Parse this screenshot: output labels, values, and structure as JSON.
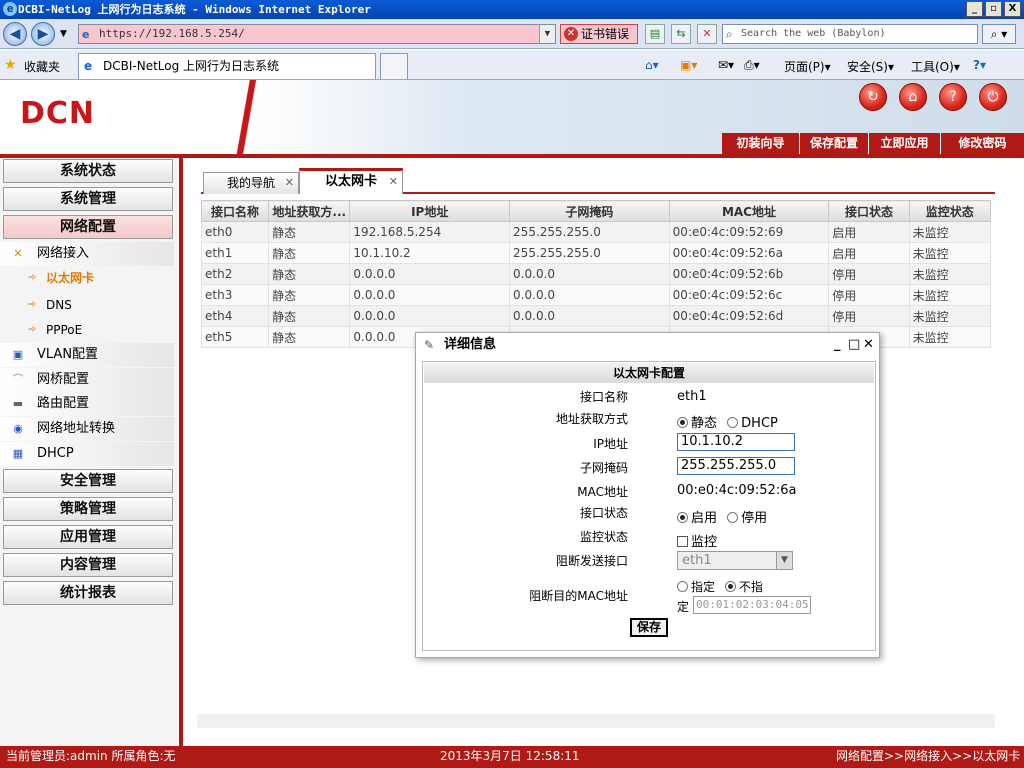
{
  "window": {
    "title": "DCBI-NetLog 上网行为日志系统 - Windows Internet Explorer",
    "controls": [
      "_",
      "▫",
      "X"
    ]
  },
  "browser": {
    "back": "◀",
    "forward": "▶",
    "dropdown": "▼",
    "address": "https://192.168.5.254/",
    "cert_error": "证书错误",
    "search_placeholder": "Search the web (Babylon)",
    "favorites_label": "收藏夹",
    "tab_title": "DCBI-NetLog 上网行为日志系统",
    "commands": {
      "page": "页面(P)",
      "safety": "安全(S)",
      "tools": "工具(O)"
    }
  },
  "app": {
    "logo": "DCN",
    "header_links": [
      "初装向导",
      "保存配置",
      "立即应用",
      "修改密码"
    ]
  },
  "sidebar": {
    "menu": {
      "status": "系统状态",
      "system": "系统管理",
      "network": "网络配置",
      "security": "安全管理",
      "policy": "策略管理",
      "application": "应用管理",
      "content": "内容管理",
      "report": "统计报表"
    },
    "network_items": {
      "access": "网络接入",
      "ethernet": "以太网卡",
      "dns": "DNS",
      "pppoe": "PPPoE",
      "vlan": "VLAN配置",
      "bridge": "网桥配置",
      "route": "路由配置",
      "nat": "网络地址转换",
      "dhcp": "DHCP"
    }
  },
  "tabs": {
    "nav": "我的导航",
    "ethernet": "以太网卡"
  },
  "table": {
    "columns": [
      "接口名称",
      "地址获取方...",
      "IP地址",
      "子网掩码",
      "MAC地址",
      "接口状态",
      "监控状态"
    ],
    "rows": [
      [
        "eth0",
        "静态",
        "192.168.5.254",
        "255.255.255.0",
        "00:e0:4c:09:52:69",
        "启用",
        "未监控"
      ],
      [
        "eth1",
        "静态",
        "10.1.10.2",
        "255.255.255.0",
        "00:e0:4c:09:52:6a",
        "启用",
        "未监控"
      ],
      [
        "eth2",
        "静态",
        "0.0.0.0",
        "0.0.0.0",
        "00:e0:4c:09:52:6b",
        "停用",
        "未监控"
      ],
      [
        "eth3",
        "静态",
        "0.0.0.0",
        "0.0.0.0",
        "00:e0:4c:09:52:6c",
        "停用",
        "未监控"
      ],
      [
        "eth4",
        "静态",
        "0.0.0.0",
        "0.0.0.0",
        "00:e0:4c:09:52:6d",
        "停用",
        "未监控"
      ],
      [
        "eth5",
        "静态",
        "0.0.0.0",
        "",
        "",
        "",
        "未监控"
      ]
    ]
  },
  "dialog": {
    "title": "详细信息",
    "controls": {
      "min": "_",
      "max": "□",
      "close": "✕"
    },
    "section": "以太网卡配置",
    "labels": {
      "name": "接口名称",
      "mode": "地址获取方式",
      "ip": "IP地址",
      "mask": "子网掩码",
      "mac": "MAC地址",
      "state": "接口状态",
      "monitor": "监控状态",
      "block_if": "阻断发送接口",
      "block_mac": "阻断目的MAC地址"
    },
    "values": {
      "name": "eth1",
      "mode_static": "静态",
      "mode_dhcp": "DHCP",
      "ip": "10.1.10.2",
      "mask": "255.255.255.0",
      "mac": "00:e0:4c:09:52:6a",
      "state_on": "启用",
      "state_off": "停用",
      "monitor": "监控",
      "block_if": "eth1",
      "specify": "指定",
      "not_specify_1": "不指",
      "not_specify_2": "定",
      "block_mac": "00:01:02:03:04:05"
    },
    "save": "保存"
  },
  "status": {
    "admin": "当前管理员:admin  所属角色:无",
    "time": "2013年3月7日 12:58:11",
    "path": "网络配置>>网络接入>>以太网卡"
  },
  "colors": {
    "brand": "#b01a16",
    "logo": "#c8161d"
  }
}
